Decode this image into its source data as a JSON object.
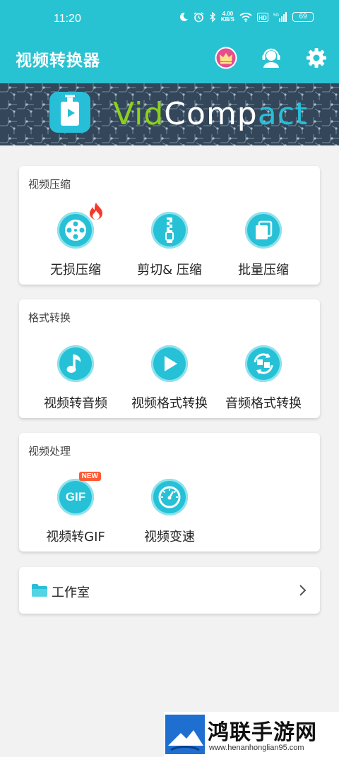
{
  "status": {
    "time": "11:20",
    "net_speed_value": "4.00",
    "net_speed_unit": "KB/S",
    "signal_label": "5G",
    "hd_label": "HD",
    "battery": "69"
  },
  "app_bar": {
    "title": "视频转换器",
    "accent": "#28c3d2"
  },
  "banner": {
    "brand_vid": "Vid",
    "brand_comp": "Comp",
    "brand_act": "act"
  },
  "sections": {
    "compress": {
      "title": "视频压缩",
      "items": [
        {
          "label": "无损压缩",
          "icon": "film-reel-icon",
          "badge": "fire-icon"
        },
        {
          "label": "剪切& 压缩",
          "icon": "zipper-icon"
        },
        {
          "label": "批量压缩",
          "icon": "stack-icon"
        }
      ]
    },
    "convert": {
      "title": "格式转换",
      "items": [
        {
          "label": "视频转音频",
          "icon": "music-note-icon"
        },
        {
          "label": "视频格式转换",
          "icon": "play-icon"
        },
        {
          "label": "音频格式转换",
          "icon": "convert-arrows-icon"
        }
      ]
    },
    "process": {
      "title": "视频处理",
      "items": [
        {
          "label": "视频转GIF",
          "icon": "gif-icon",
          "badge": "NEW",
          "icon_text": "GIF"
        },
        {
          "label": "视频变速",
          "icon": "speedometer-icon"
        }
      ]
    }
  },
  "studio": {
    "label": "工作室"
  },
  "watermark": {
    "name": "鸿联手游网",
    "url": "www.henanhonglian95.com"
  }
}
